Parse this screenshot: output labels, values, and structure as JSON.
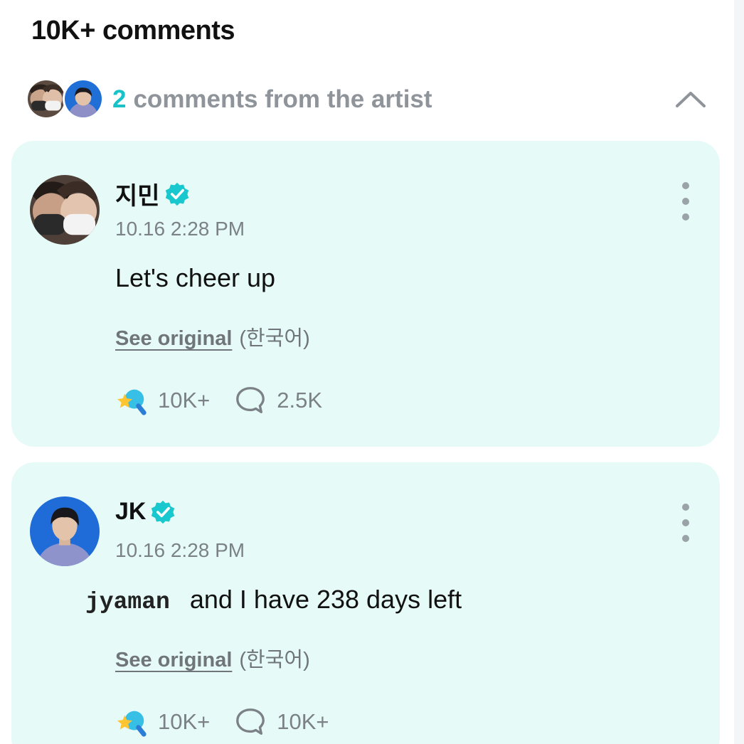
{
  "header": {
    "title": "10K+ comments"
  },
  "artist_summary": {
    "count": "2",
    "text": "comments from the artist",
    "avatars": [
      "avatar-jimin",
      "avatar-jk"
    ],
    "collapse_icon": "chevron-up-icon"
  },
  "comments": [
    {
      "author": "지민",
      "verified_icon": "verified-badge-icon",
      "timestamp": "10.16 2:28 PM",
      "body": "Let's cheer up",
      "see_original": "See original",
      "language": "(한국어)",
      "likes": "10K+",
      "replies": "2.5K",
      "more_icon": "kebab-menu-icon"
    },
    {
      "author": "JK",
      "verified_icon": "verified-badge-icon",
      "timestamp": "10.16 2:28 PM",
      "tag": "jyaman",
      "body": "and I have 238 days left",
      "see_original": "See original",
      "language": "(한국어)",
      "likes": "10K+",
      "replies": "10K+",
      "more_icon": "kebab-menu-icon"
    }
  ],
  "colors": {
    "accent": "#17c3c8",
    "card_bg": "#e6fbf7",
    "muted_text": "#7b8186"
  }
}
